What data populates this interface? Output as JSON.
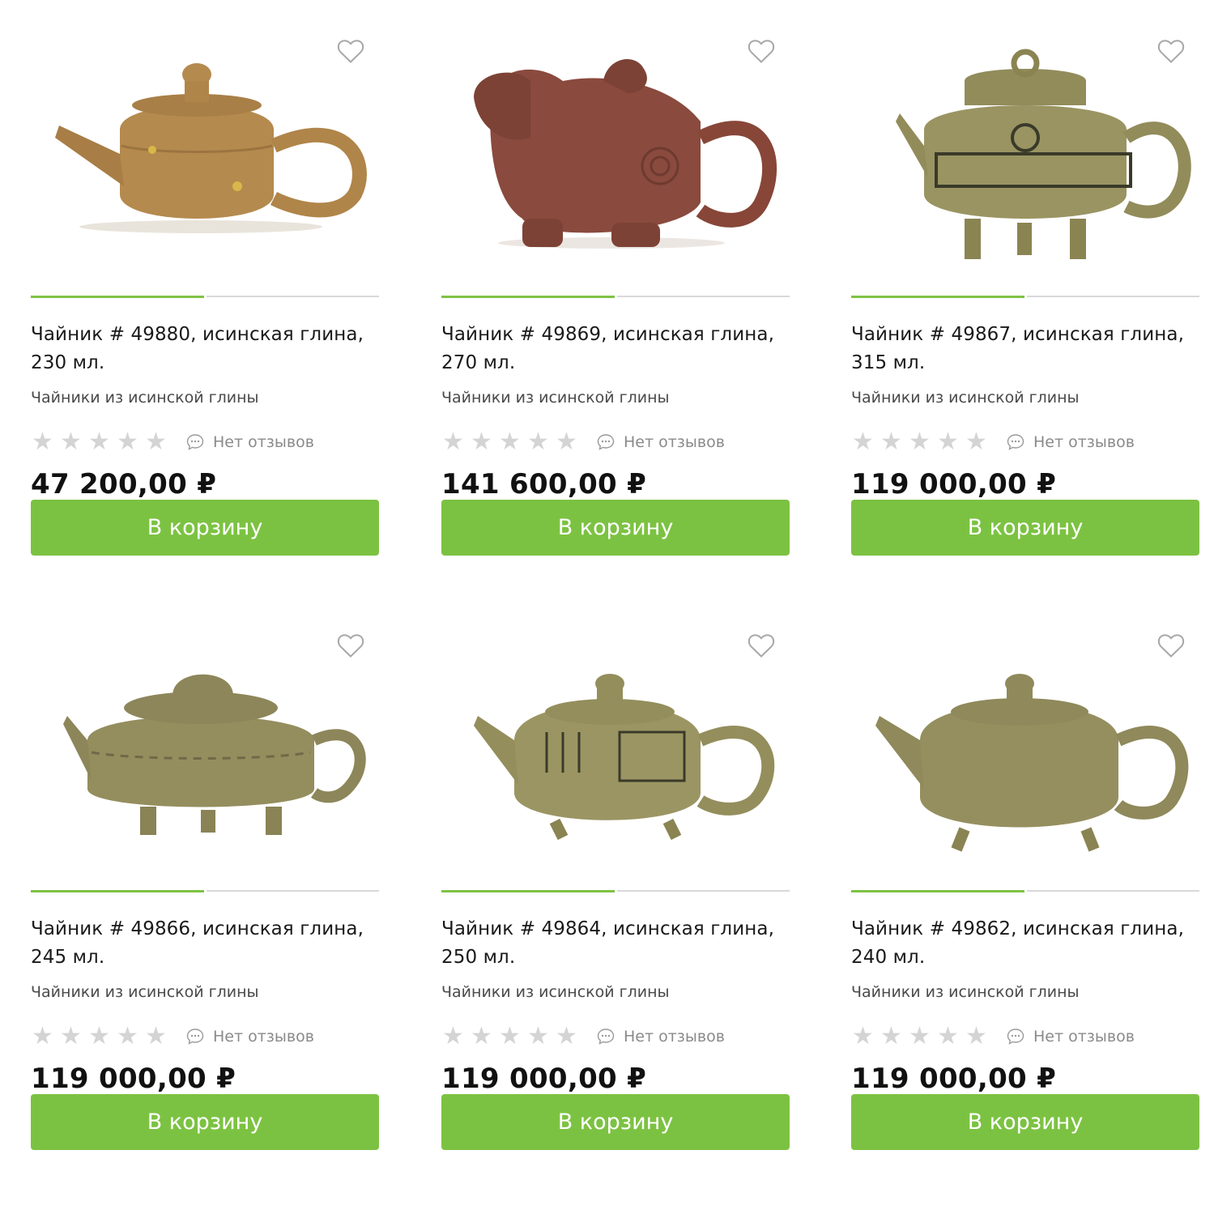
{
  "products": [
    {
      "title": "Чайник # 49880, исинская глина, 230 мл.",
      "category": "Чайники из исинской глины",
      "reviews": "Нет отзывов",
      "price": "47 200,00 ₽",
      "button": "В корзину",
      "rating": 0,
      "image_color": "#b58a4e"
    },
    {
      "title": "Чайник # 49869, исинская глина, 270 мл.",
      "category": "Чайники из исинской глины",
      "reviews": "Нет отзывов",
      "price": "141 600,00 ₽",
      "button": "В корзину",
      "rating": 0,
      "image_color": "#8a4a3e"
    },
    {
      "title": "Чайник # 49867, исинская глина, 315 мл.",
      "category": "Чайники из исинской глины",
      "reviews": "Нет отзывов",
      "price": "119 000,00 ₽",
      "button": "В корзину",
      "rating": 0,
      "image_color": "#9a9462"
    },
    {
      "title": "Чайник # 49866, исинская глина, 245 мл.",
      "category": "Чайники из исинской глины",
      "reviews": "Нет отзывов",
      "price": "119 000,00 ₽",
      "button": "В корзину",
      "rating": 0,
      "image_color": "#948d5e"
    },
    {
      "title": "Чайник # 49864, исинская глина, 250 мл.",
      "category": "Чайники из исинской глины",
      "reviews": "Нет отзывов",
      "price": "119 000,00 ₽",
      "button": "В корзину",
      "rating": 0,
      "image_color": "#9b9563"
    },
    {
      "title": "Чайник # 49862, исинская глина, 240 мл.",
      "category": "Чайники из исинской глины",
      "reviews": "Нет отзывов",
      "price": "119 000,00 ₽",
      "button": "В корзину",
      "rating": 0,
      "image_color": "#958f60"
    }
  ],
  "icons": {
    "favorite": "heart-outline-icon",
    "star": "star-icon",
    "reviews": "speech-bubble-icon"
  },
  "colors": {
    "accent": "#7cc242",
    "star_empty": "#d4d4d4"
  }
}
